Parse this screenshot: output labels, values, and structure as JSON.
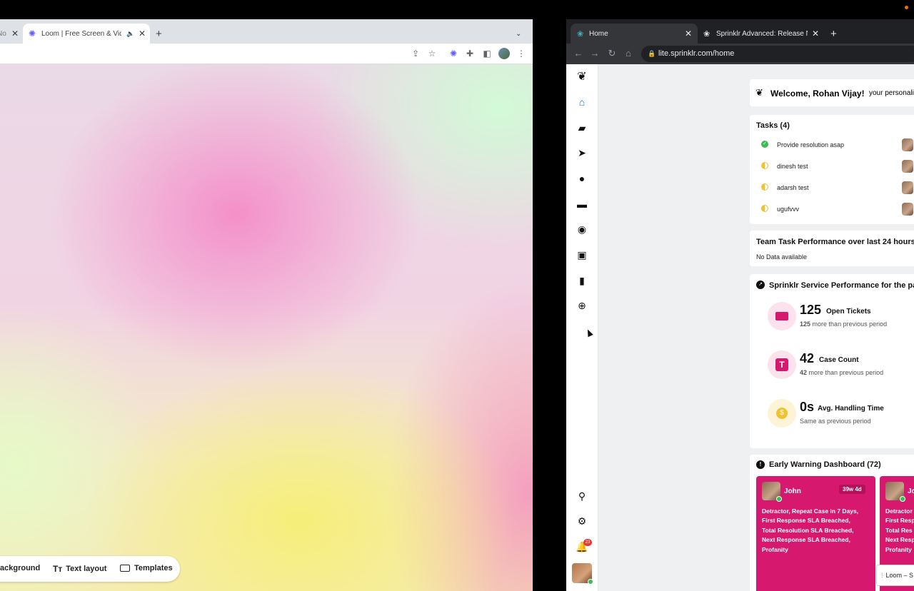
{
  "left_window": {
    "tabs": [
      {
        "label": "No"
      },
      {
        "label": "Loom | Free Screen & Vide"
      }
    ],
    "bottom_toolbar": {
      "background_label": "ackground",
      "text_layout_label": "Text layout",
      "templates_label": "Templates"
    }
  },
  "right_window": {
    "tabs": [
      {
        "label": "Home"
      },
      {
        "label": "Sprinklr Advanced: Release No"
      }
    ],
    "url": "lite.sprinklr.com/home",
    "welcome": {
      "greeting": "Welcome, Rohan Vijay!",
      "suffix": "your personali"
    },
    "tasks": {
      "title": "Tasks (4)",
      "items": [
        {
          "label": "Provide resolution asap",
          "status": "done"
        },
        {
          "label": "dinesh test",
          "status": "in-progress"
        },
        {
          "label": "adarsh test",
          "status": "in-progress"
        },
        {
          "label": "ugufvvv",
          "status": "in-progress"
        }
      ]
    },
    "team_performance": {
      "title": "Team Task Performance over last 24 hours",
      "empty_text": "No Data available"
    },
    "service_performance": {
      "title": "Sprinklr Service Performance for the pa",
      "metrics": [
        {
          "value": "125",
          "label": "Open Tickets",
          "sub_bold": "125",
          "sub_text": "more than previous period"
        },
        {
          "value": "42",
          "label": "Case Count",
          "sub_bold": "42",
          "sub_text": "more than previous period"
        },
        {
          "value": "0s",
          "label": "Avg. Handling Time",
          "sub_bold": "",
          "sub_text": "Same as previous period"
        }
      ]
    },
    "early_warning": {
      "title": "Early Warning Dashboard (72)",
      "cards": [
        {
          "name": "John",
          "age": "39w 4d",
          "lines": [
            "Detractor, Repeat Case in 7 Days,",
            "First Response SLA Breached,",
            "Total Resolution SLA Breached,",
            "Next Response SLA Breached,",
            "Profanity"
          ]
        },
        {
          "name": "Jo",
          "age": "",
          "lines": [
            "Detractor",
            "First Resp",
            "Total Res",
            "Next Resp",
            "Profanity"
          ]
        }
      ]
    },
    "notification_count": "23",
    "loom_popup": "Loom – S"
  },
  "colors": {
    "accent_blue": "#1a73e8",
    "pink": "#d6196e",
    "green": "#3cba54",
    "amber": "#f2c12e"
  }
}
